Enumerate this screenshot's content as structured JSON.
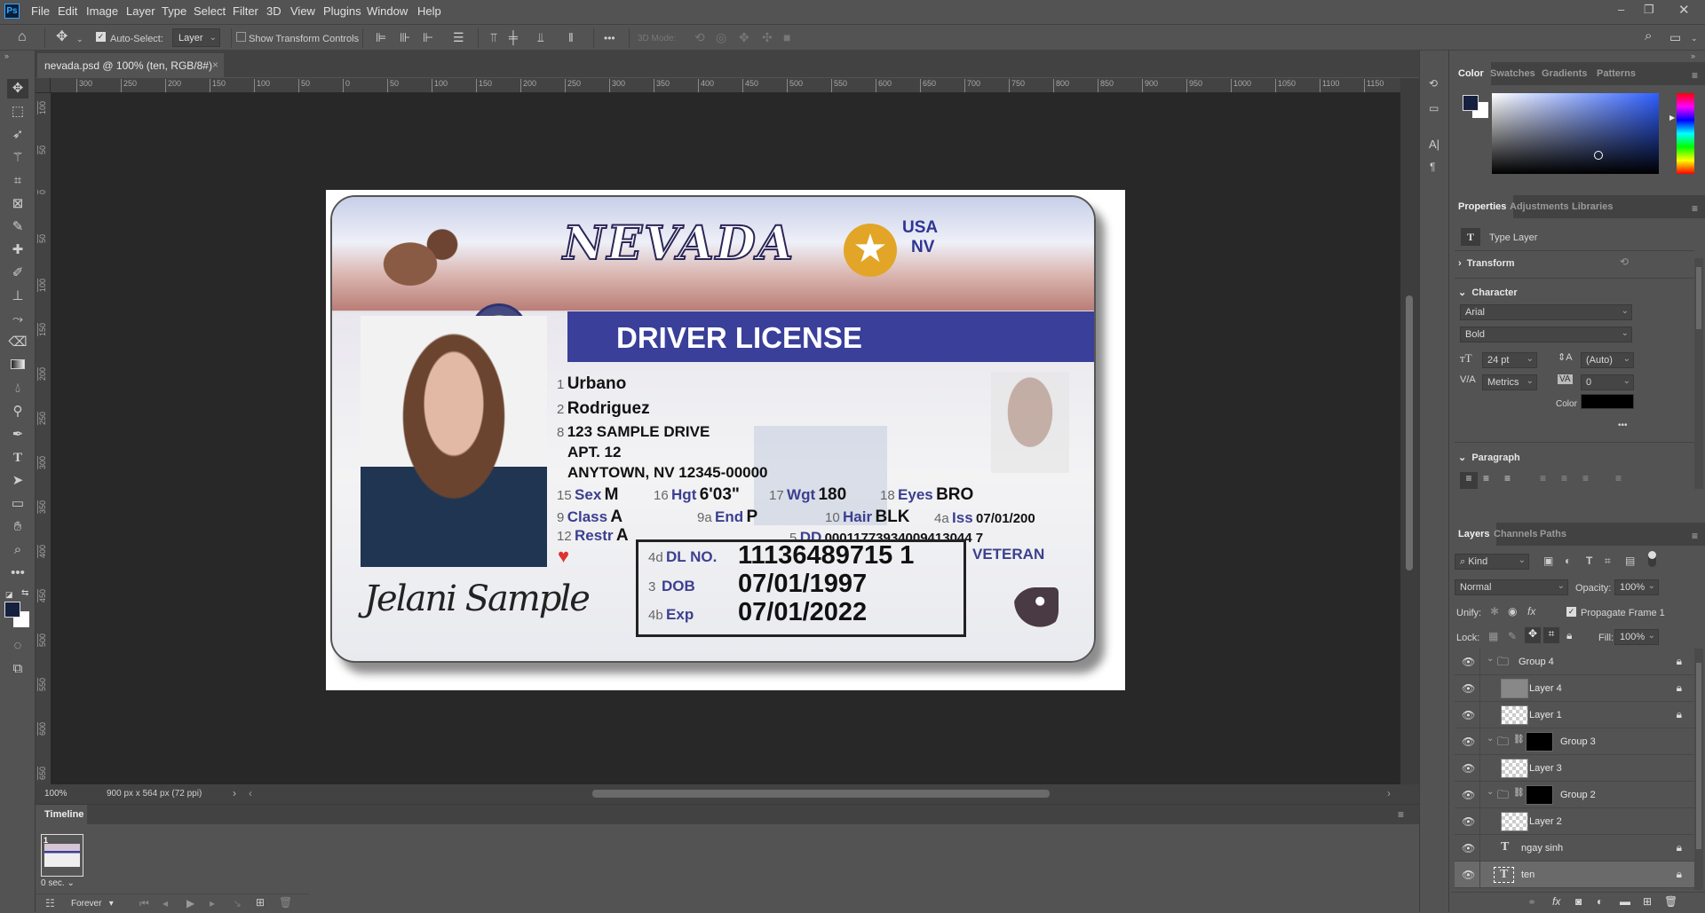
{
  "app": {
    "logo": "Ps",
    "menu": [
      "File",
      "Edit",
      "Image",
      "Layer",
      "Type",
      "Select",
      "Filter",
      "3D",
      "View",
      "Plugins",
      "Window",
      "Help"
    ]
  },
  "options": {
    "auto_select_label": "Auto-Select:",
    "auto_select_checked": true,
    "auto_select_target": "Layer",
    "show_transform_label": "Show Transform Controls",
    "more": "•••",
    "mode_3d": "3D Mode:"
  },
  "document": {
    "tab_title": "nevada.psd @ 100% (ten, RGB/8#)",
    "zoom": "100%",
    "info": "900 px x 564 px (72 ppi)"
  },
  "rulers": {
    "h": [
      300,
      250,
      200,
      150,
      100,
      50,
      0,
      50,
      100,
      150,
      200,
      250,
      300,
      350,
      400,
      450,
      500,
      550,
      600,
      650,
      700,
      750,
      800,
      850,
      900,
      950,
      1000,
      1050,
      1100,
      1150
    ],
    "v": [
      100,
      50,
      0,
      50,
      100,
      150,
      200,
      250,
      300,
      350,
      400,
      450,
      500,
      550,
      600,
      650
    ]
  },
  "card": {
    "state": "NEVADA",
    "country": "USA",
    "state_code": "NV",
    "title": "DRIVER LICENSE",
    "fields": {
      "first_name": {
        "num": "1",
        "value": "Urbano"
      },
      "last_name": {
        "num": "2",
        "value": "Rodriguez"
      },
      "address": {
        "num": "8",
        "line1": "123 SAMPLE DRIVE",
        "line2": "APT. 12",
        "line3": "ANYTOWN, NV 12345-00000"
      },
      "sex": {
        "num": "15",
        "label": "Sex",
        "value": "M"
      },
      "height": {
        "num": "16",
        "label": "Hgt",
        "value": "6'03\""
      },
      "weight": {
        "num": "17",
        "label": "Wgt",
        "value": "180"
      },
      "eyes": {
        "num": "18",
        "label": "Eyes",
        "value": "BRO"
      },
      "class": {
        "num": "9",
        "label": "Class",
        "value": "A"
      },
      "endorsement": {
        "num": "9a",
        "label": "End",
        "value": "P"
      },
      "hair": {
        "num": "10",
        "label": "Hair",
        "value": "BLK"
      },
      "issued": {
        "num": "4a",
        "label": "Iss",
        "value": "07/01/200"
      },
      "restriction": {
        "num": "12",
        "label": "Restr",
        "value": "A"
      },
      "dd": {
        "num": "5",
        "label": "DD",
        "value": "00011773934009413044 7"
      },
      "dl_no": {
        "num": "4d",
        "label": "DL NO.",
        "value": "11136489715 1"
      },
      "dob": {
        "num": "3",
        "label": "DOB",
        "value": "07/01/1997"
      },
      "exp": {
        "num": "4b",
        "label": "Exp",
        "value": "07/01/2022"
      }
    },
    "veteran": "VETERAN",
    "signature": "Jelani Sample",
    "colors": {
      "band": "#3a3f9a",
      "label": "#3c3f8f",
      "star": "#e2a527"
    }
  },
  "color_panel": {
    "tabs": [
      "Color",
      "Swatches",
      "Gradients",
      "Patterns"
    ],
    "foreground": "#16213f",
    "background": "#ffffff"
  },
  "properties": {
    "tabs": [
      "Properties",
      "Adjustments",
      "Libraries"
    ],
    "type": "Type Layer",
    "transform": "Transform",
    "character": "Character",
    "font": "Arial",
    "style": "Bold",
    "size": "24 pt",
    "leading": "(Auto)",
    "kerning": "Metrics",
    "tracking": "0",
    "color_label": "Color",
    "text_color": "#000000",
    "more": "•••",
    "paragraph": "Paragraph"
  },
  "layers": {
    "tabs": [
      "Layers",
      "Channels",
      "Paths"
    ],
    "filter": "Kind",
    "blend": "Normal",
    "opacity_label": "Opacity:",
    "opacity": "100%",
    "unify_label": "Unify:",
    "propagate": "Propagate Frame 1",
    "lock_label": "Lock:",
    "fill_label": "Fill:",
    "fill": "100%",
    "items": [
      {
        "name": "Group 4",
        "kind": "group",
        "locked": true
      },
      {
        "name": "Layer 4",
        "kind": "gray",
        "locked": true
      },
      {
        "name": "Layer 1",
        "kind": "pixel",
        "locked": true
      },
      {
        "name": "Group 3",
        "kind": "group-mask",
        "locked": false
      },
      {
        "name": "Layer 3",
        "kind": "pixel",
        "locked": false
      },
      {
        "name": "Group 2",
        "kind": "group-mask",
        "locked": false
      },
      {
        "name": "Layer 2",
        "kind": "pixel",
        "locked": false
      },
      {
        "name": "ngay sinh",
        "kind": "text",
        "locked": true
      },
      {
        "name": "ten",
        "kind": "text",
        "locked": true,
        "selected": true
      }
    ]
  },
  "timeline": {
    "title": "Timeline",
    "frame_number": "1",
    "frame_delay": "0 sec.",
    "loop": "Forever"
  }
}
